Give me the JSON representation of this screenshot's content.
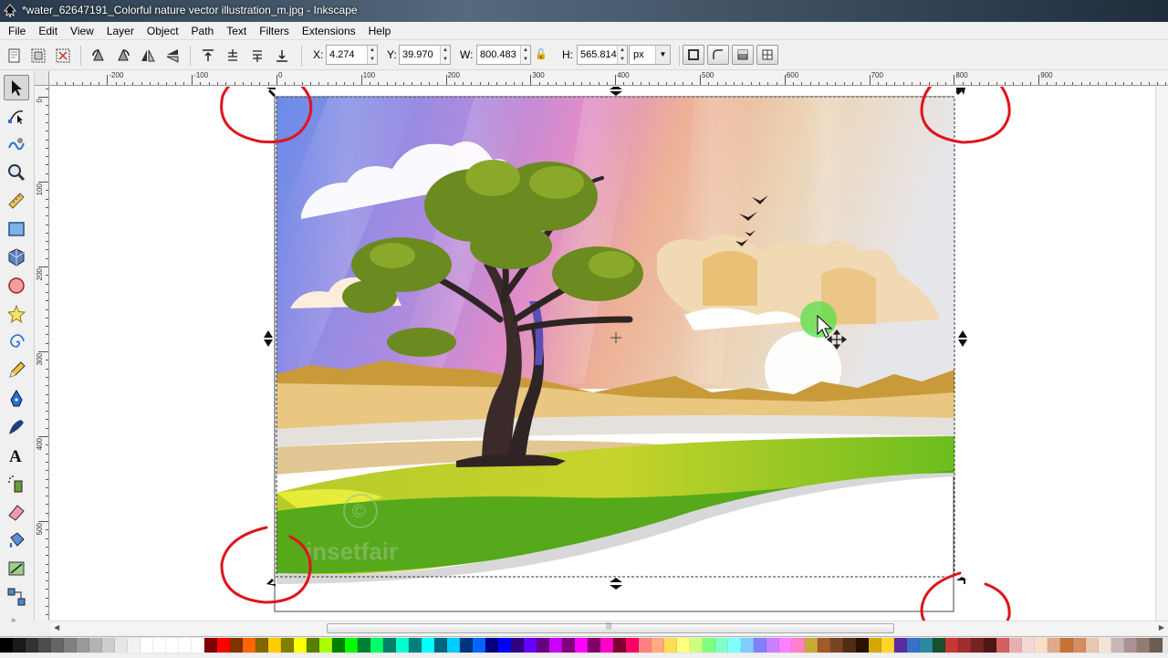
{
  "window": {
    "title": "*water_62647191_Colorful nature vector illustration_m.jpg - Inkscape"
  },
  "menu": [
    "File",
    "Edit",
    "View",
    "Layer",
    "Object",
    "Path",
    "Text",
    "Filters",
    "Extensions",
    "Help"
  ],
  "toolbar": {
    "x_label": "X:",
    "x_value": "4.274",
    "y_label": "Y:",
    "y_value": "39.970",
    "w_label": "W:",
    "w_value": "800.483",
    "h_label": "H:",
    "h_value": "565.814",
    "unit": "px"
  },
  "ruler": {
    "top_labels": [
      "-200",
      "-100",
      "0",
      "100",
      "200",
      "300",
      "400",
      "500",
      "600",
      "700",
      "800",
      "900"
    ],
    "left_labels": [
      "0",
      "100",
      "200",
      "300",
      "400",
      "500"
    ]
  },
  "tools": [
    "selector",
    "node",
    "tweak",
    "zoom",
    "measure",
    "rectangle",
    "3d-box",
    "ellipse",
    "star",
    "spiral",
    "pencil",
    "pen",
    "calligraphy",
    "text",
    "spray",
    "eraser",
    "bucket",
    "gradient",
    "connector"
  ],
  "artwork": {
    "watermark_symbol": "©",
    "watermark_text": "insetfair"
  },
  "colors": {
    "annotation_red": "#e0141b",
    "cursor_highlight": "#55e04a"
  },
  "palette": [
    "#000000",
    "#1a1a1a",
    "#333333",
    "#4d4d4d",
    "#666666",
    "#808080",
    "#999999",
    "#b3b3b3",
    "#cccccc",
    "#e6e6e6",
    "#f2f2f2",
    "#ffffff",
    "#ffffff",
    "#ffffff",
    "#ffffff",
    "#ffffff",
    "#800000",
    "#ff0000",
    "#803300",
    "#ff6600",
    "#806600",
    "#ffcc00",
    "#808000",
    "#ffff00",
    "#558000",
    "#aaff00",
    "#008000",
    "#00ff00",
    "#008033",
    "#00ff66",
    "#008066",
    "#00ffcc",
    "#008080",
    "#00ffff",
    "#006680",
    "#00ccff",
    "#003380",
    "#0066ff",
    "#000080",
    "#0000ff",
    "#330080",
    "#6600ff",
    "#660080",
    "#cc00ff",
    "#800080",
    "#ff00ff",
    "#800066",
    "#ff00cc",
    "#800033",
    "#ff0066",
    "#ff8080",
    "#ffaa80",
    "#ffdd55",
    "#ffff80",
    "#ccff80",
    "#80ff80",
    "#80ffcc",
    "#80ffff",
    "#80ccff",
    "#8080ff",
    "#cc80ff",
    "#ff80ff",
    "#ff80cc",
    "#c8ab37",
    "#a05a2c",
    "#784421",
    "#502d16",
    "#2b1100",
    "#d4aa00",
    "#ffd42a",
    "#5a2ca0",
    "#3771c8",
    "#2c89a0",
    "#16502d",
    "#c83737",
    "#a02c2c",
    "#782121",
    "#501616",
    "#d35f5f",
    "#e9afaf",
    "#f4d7d7",
    "#f8e0c8",
    "#deaa87",
    "#c87137",
    "#d38d5f",
    "#e9c6af",
    "#f4e3d7",
    "#c8b7b7",
    "#ac9393",
    "#917c6f",
    "#6c5d53"
  ]
}
